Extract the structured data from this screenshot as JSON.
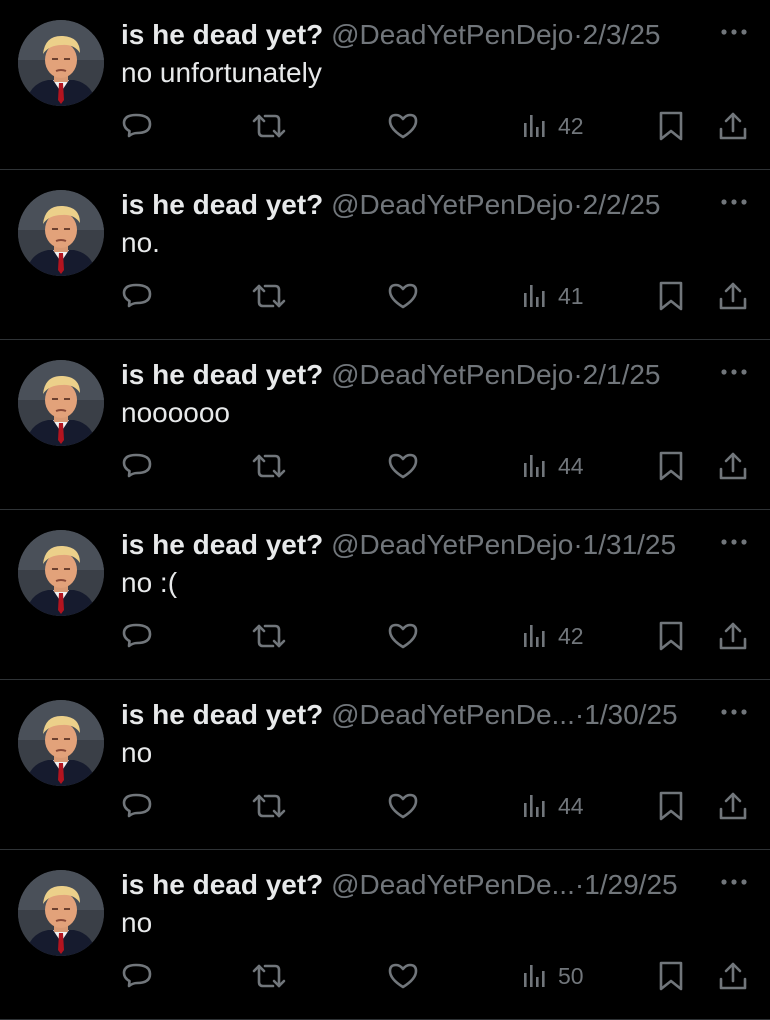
{
  "colors": {
    "background": "#000000",
    "text_primary": "#e7e9ea",
    "text_secondary": "#71767b",
    "divider": "#2f3336"
  },
  "icons": {
    "reply": "reply-icon",
    "retweet": "retweet-icon",
    "like": "heart-icon",
    "views": "analytics-icon",
    "bookmark": "bookmark-icon",
    "share": "share-icon",
    "more": "more-options-icon"
  },
  "tweets": [
    {
      "display_name": "is he dead yet?",
      "handle": "@DeadYetPenDejo",
      "separator": "·",
      "date": "2/3/25",
      "text": "no unfortunately",
      "views": "42"
    },
    {
      "display_name": "is he dead yet?",
      "handle": "@DeadYetPenDejo",
      "separator": "·",
      "date": "2/2/25",
      "text": "no.",
      "views": "41"
    },
    {
      "display_name": "is he dead yet?",
      "handle": "@DeadYetPenDejo",
      "separator": "·",
      "date": "2/1/25",
      "text": "noooooo",
      "views": "44"
    },
    {
      "display_name": "is he dead yet?",
      "handle": "@DeadYetPenDejo",
      "separator": "·",
      "date": "1/31/25",
      "text": "no :(",
      "views": "42"
    },
    {
      "display_name": "is he dead yet?",
      "handle": "@DeadYetPenDe...",
      "separator": "·",
      "date": "1/30/25",
      "text": "no",
      "views": "44"
    },
    {
      "display_name": "is he dead yet?",
      "handle": "@DeadYetPenDe...",
      "separator": "·",
      "date": "1/29/25",
      "text": "no",
      "views": "50"
    }
  ]
}
